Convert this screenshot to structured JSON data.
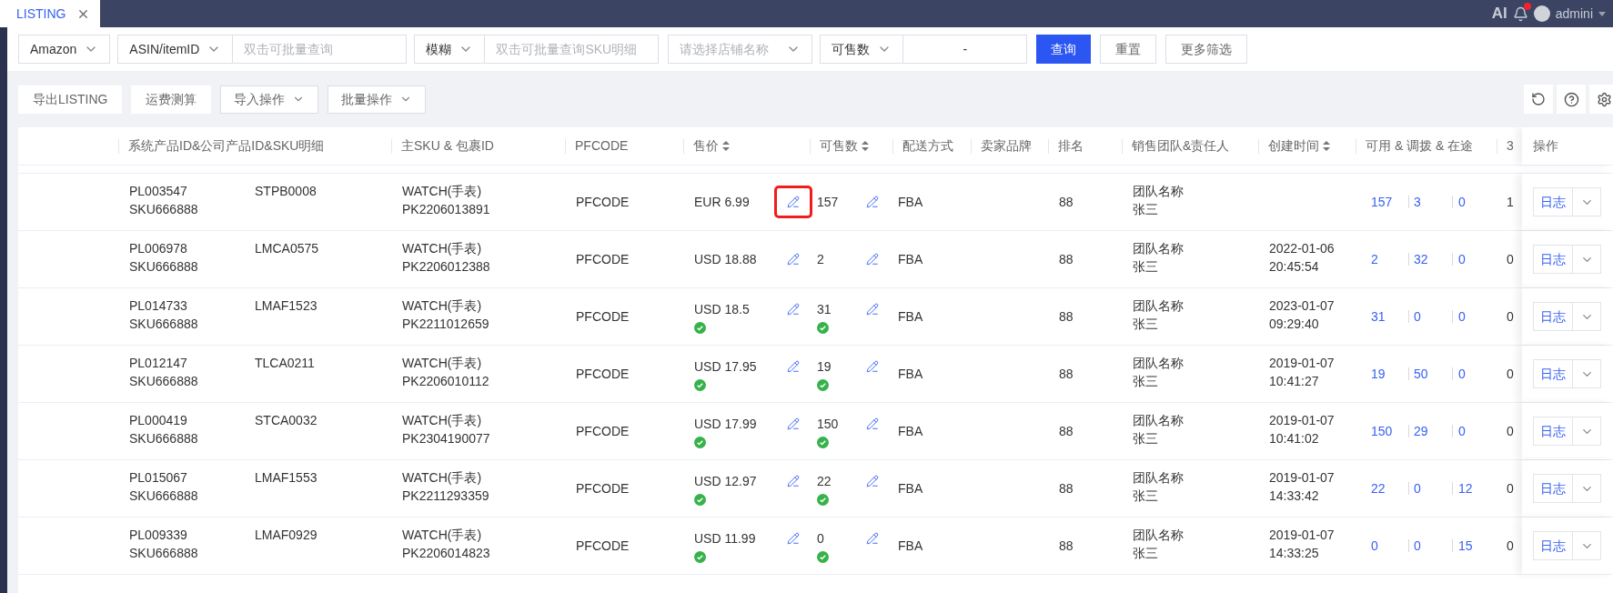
{
  "top_bar": {
    "tab": {
      "label": "LISTING",
      "selected": true
    },
    "ai_label": "AI",
    "notification_unread": true,
    "user": "admini"
  },
  "filters": [
    {
      "kind": "select",
      "value": "Amazon"
    },
    {
      "kind": "select",
      "value": "ASIN/itemID"
    },
    {
      "kind": "input",
      "placeholder": "双击可批量查询"
    },
    {
      "kind": "select",
      "value": "模糊"
    },
    {
      "kind": "input",
      "placeholder": "双击可批量查询SKU明细"
    },
    {
      "kind": "select",
      "placeholder": "请选择店铺名称"
    },
    {
      "kind": "select",
      "value": "可售数"
    },
    {
      "kind": "range",
      "separator": "-"
    }
  ],
  "filter_buttons": [
    {
      "label": "查询",
      "primary": true
    },
    {
      "label": "重置",
      "primary": false
    },
    {
      "label": "更多筛选",
      "primary": false
    }
  ],
  "toolbar": [
    {
      "label": "导出LISTING",
      "dropdown": false
    },
    {
      "label": "运费测算",
      "dropdown": false
    },
    {
      "label": "导入操作",
      "dropdown": true
    },
    {
      "label": "批量操作",
      "dropdown": true
    }
  ],
  "table": {
    "columns": [
      {
        "label": "系统产品ID&公司产品ID&SKU明细"
      },
      {
        "label": "主SKU & 包裹ID"
      },
      {
        "label": "PFCODE"
      },
      {
        "label": "售价",
        "sortable": true
      },
      {
        "label": "可售数",
        "sortable": true
      },
      {
        "label": "配送方式"
      },
      {
        "label": "卖家品牌"
      },
      {
        "label": "排名"
      },
      {
        "label": "销售团队&责任人"
      },
      {
        "label": "创建时间",
        "sortable": true
      },
      {
        "label": "可用 & 调拨 & 在途"
      },
      {
        "label": "3"
      },
      {
        "label": "操作"
      }
    ],
    "rows": [
      {
        "product_id": "PL003547",
        "sku": "SKU666888",
        "company_id": "STPB0008",
        "main_sku": "WATCH(手表)",
        "package_id": "PK2206013891",
        "pfcode": "PFCODE",
        "price": "EUR 6.99",
        "price_verified": false,
        "price_edit_highlighted": true,
        "stock": "157",
        "stock_verified": false,
        "shipping": "FBA",
        "rank": "88",
        "team": "团队名称",
        "owner": "张三",
        "available": "157",
        "transfer": "3",
        "in_transit": "0",
        "column_13": "1",
        "log_button": "日志"
      },
      {
        "product_id": "PL006978",
        "sku": "SKU666888",
        "company_id": "LMCA0575",
        "main_sku": "WATCH(手表)",
        "package_id": "PK2206012388",
        "pfcode": "PFCODE",
        "price": "USD 18.88",
        "price_verified": false,
        "price_edit_highlighted": false,
        "stock": "2",
        "stock_verified": false,
        "shipping": "FBA",
        "rank": "88",
        "team": "团队名称",
        "owner": "张三",
        "created_date": "2022-01-06",
        "created_time": "20:45:54",
        "available": "2",
        "transfer": "32",
        "in_transit": "0",
        "column_13": "0",
        "log_button": "日志"
      },
      {
        "product_id": "PL014733",
        "sku": "SKU666888",
        "company_id": "LMAF1523",
        "main_sku": "WATCH(手表)",
        "package_id": "PK2211012659",
        "pfcode": "PFCODE",
        "price": "USD 18.5",
        "price_verified": true,
        "price_edit_highlighted": false,
        "stock": "31",
        "stock_verified": true,
        "shipping": "FBA",
        "rank": "88",
        "team": "团队名称",
        "owner": "张三",
        "created_date": "2023-01-07",
        "created_time": "09:29:40",
        "available": "31",
        "transfer": "0",
        "in_transit": "0",
        "column_13": "0",
        "log_button": "日志"
      },
      {
        "product_id": "PL012147",
        "sku": "SKU666888",
        "company_id": "TLCA0211",
        "main_sku": "WATCH(手表)",
        "package_id": "PK2206010112",
        "pfcode": "PFCODE",
        "price": "USD 17.95",
        "price_verified": true,
        "price_edit_highlighted": false,
        "stock": "19",
        "stock_verified": true,
        "shipping": "FBA",
        "rank": "88",
        "team": "团队名称",
        "owner": "张三",
        "created_date": "2019-01-07",
        "created_time": "10:41:27",
        "available": "19",
        "transfer": "50",
        "in_transit": "0",
        "column_13": "0",
        "log_button": "日志"
      },
      {
        "product_id": "PL000419",
        "sku": "SKU666888",
        "company_id": "STCA0032",
        "main_sku": "WATCH(手表)",
        "package_id": "PK2304190077",
        "pfcode": "PFCODE",
        "price": "USD 17.99",
        "price_verified": true,
        "price_edit_highlighted": false,
        "stock": "150",
        "stock_verified": true,
        "shipping": "FBA",
        "rank": "88",
        "team": "团队名称",
        "owner": "张三",
        "created_date": "2019-01-07",
        "created_time": "10:41:02",
        "available": "150",
        "transfer": "29",
        "in_transit": "0",
        "column_13": "0",
        "log_button": "日志"
      },
      {
        "product_id": "PL015067",
        "sku": "SKU666888",
        "company_id": "LMAF1553",
        "main_sku": "WATCH(手表)",
        "package_id": "PK2211293359",
        "pfcode": "PFCODE",
        "price": "USD 12.97",
        "price_verified": true,
        "price_edit_highlighted": false,
        "stock": "22",
        "stock_verified": true,
        "shipping": "FBA",
        "rank": "88",
        "team": "团队名称",
        "owner": "张三",
        "created_date": "2019-01-07",
        "created_time": "14:33:42",
        "available": "22",
        "transfer": "0",
        "in_transit": "12",
        "column_13": "0",
        "log_button": "日志"
      },
      {
        "product_id": "PL009339",
        "sku": "SKU666888",
        "company_id": "LMAF0929",
        "main_sku": "WATCH(手表)",
        "package_id": "PK2206014823",
        "pfcode": "PFCODE",
        "price": "USD 11.99",
        "price_verified": true,
        "price_edit_highlighted": false,
        "stock": "0",
        "stock_verified": true,
        "shipping": "FBA",
        "rank": "88",
        "team": "团队名称",
        "owner": "张三",
        "created_date": "2019-01-07",
        "created_time": "14:33:25",
        "available": "0",
        "transfer": "0",
        "in_transit": "15",
        "column_13": "0",
        "log_button": "日志"
      }
    ]
  }
}
